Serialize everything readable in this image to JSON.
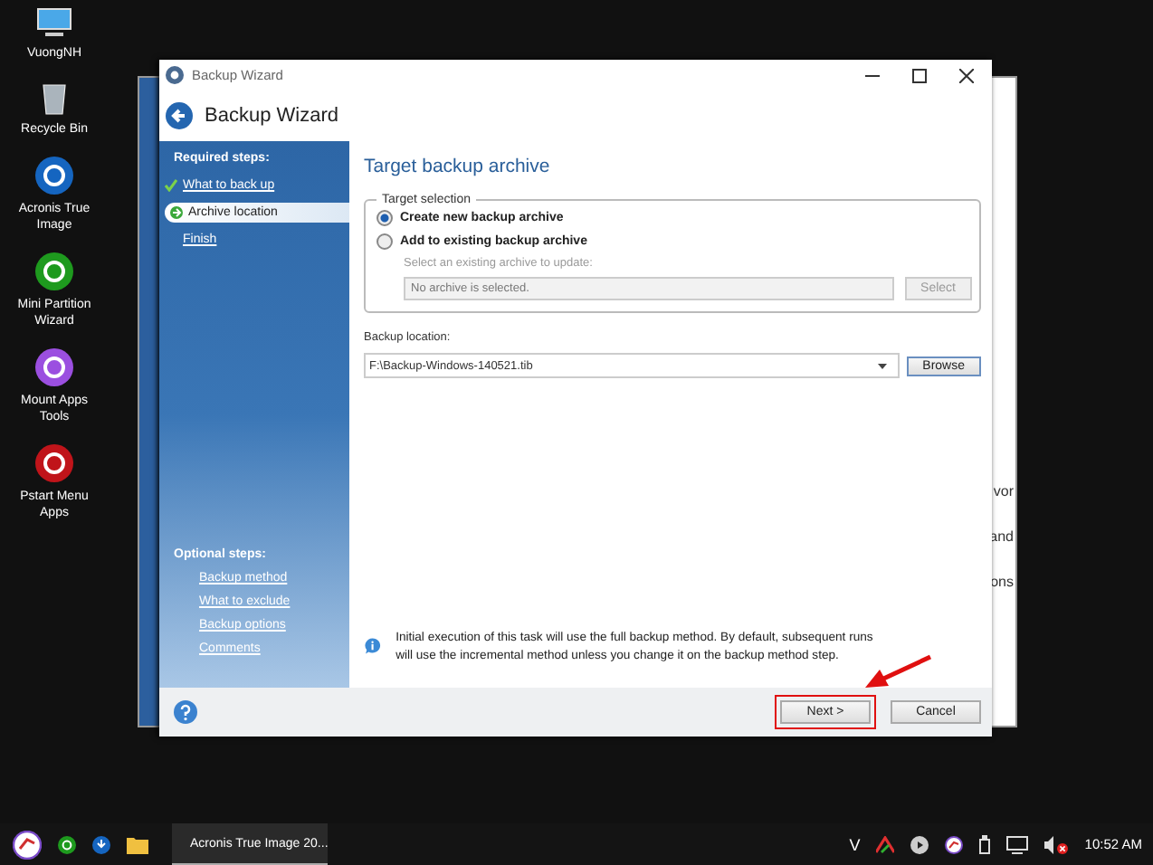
{
  "desktop_icons": [
    {
      "label": "VuongNH",
      "kind": "computer"
    },
    {
      "label": "Recycle Bin",
      "kind": "bin"
    },
    {
      "label": "Acronis True Image",
      "kind": "acronis"
    },
    {
      "label": "Mini Partition Wizard",
      "kind": "partition"
    },
    {
      "label": "Mount Apps Tools",
      "kind": "mount"
    },
    {
      "label": "Pstart Menu Apps",
      "kind": "pstart"
    }
  ],
  "background_window": {
    "fragments": [
      "vor",
      "and",
      "ons"
    ]
  },
  "wizard": {
    "title": "Backup Wizard",
    "header": "Backup Wizard",
    "sidebar": {
      "required_heading": "Required steps:",
      "required": [
        {
          "label": "What to back up",
          "done": true,
          "selected": false
        },
        {
          "label": "Archive location",
          "done": false,
          "selected": true
        },
        {
          "label": "Finish",
          "done": false,
          "selected": false
        }
      ],
      "optional_heading": "Optional steps:",
      "optional": [
        {
          "label": "Backup method"
        },
        {
          "label": "What to exclude"
        },
        {
          "label": "Backup options"
        },
        {
          "label": "Comments"
        }
      ]
    },
    "page_title": "Target backup archive",
    "group": {
      "legend": "Target selection",
      "options": [
        {
          "label": "Create new backup archive",
          "selected": true
        },
        {
          "label": "Add to existing backup archive",
          "selected": false
        }
      ],
      "existing_hint": "Select an existing archive to update:",
      "existing_placeholder": "No archive is selected.",
      "select_button": "Select",
      "disabled": true
    },
    "location_label": "Backup location:",
    "location_value": "F:\\Backup-Windows-140521.tib",
    "browse_button": "Browse",
    "info": "Initial execution of this task will use the full backup method. By default, subsequent runs will use the incremental method unless you change it on the backup method step.",
    "next_button": "Next >",
    "cancel_button": "Cancel"
  },
  "taskbar": {
    "task": "Acronis True Image 20...",
    "tray_letter": "V",
    "clock": "10:52 AM"
  }
}
